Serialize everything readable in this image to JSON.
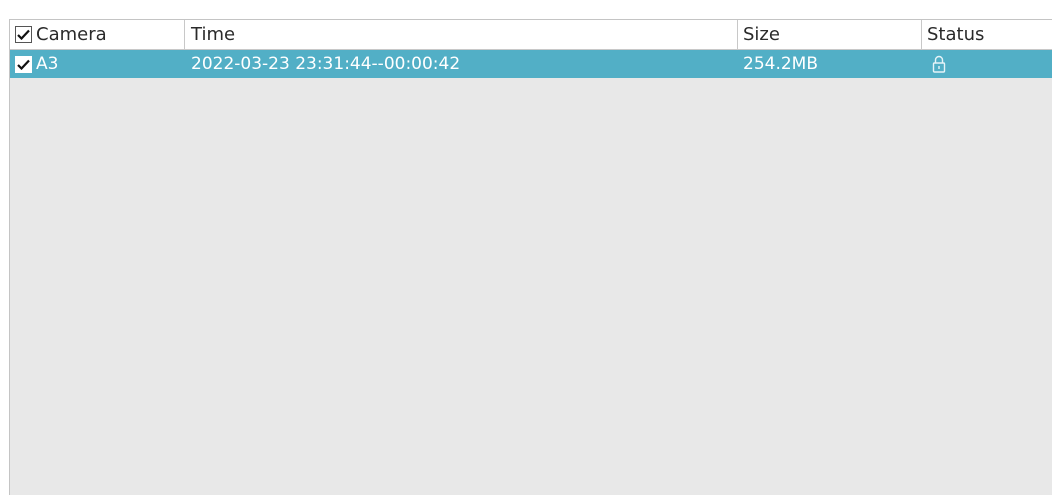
{
  "table": {
    "headers": {
      "camera": "Camera",
      "time": "Time",
      "size": "Size",
      "status": "Status"
    },
    "header_checked": true,
    "rows": [
      {
        "checked": true,
        "camera": "A3",
        "time": "2022-03-23 23:31:44--00:00:42",
        "size": "254.2MB",
        "status_icon": "lock-icon"
      }
    ]
  },
  "colors": {
    "selected_row": "#52afc6",
    "panel_bg": "#e8e8e8",
    "header_bg": "#ffffff"
  }
}
